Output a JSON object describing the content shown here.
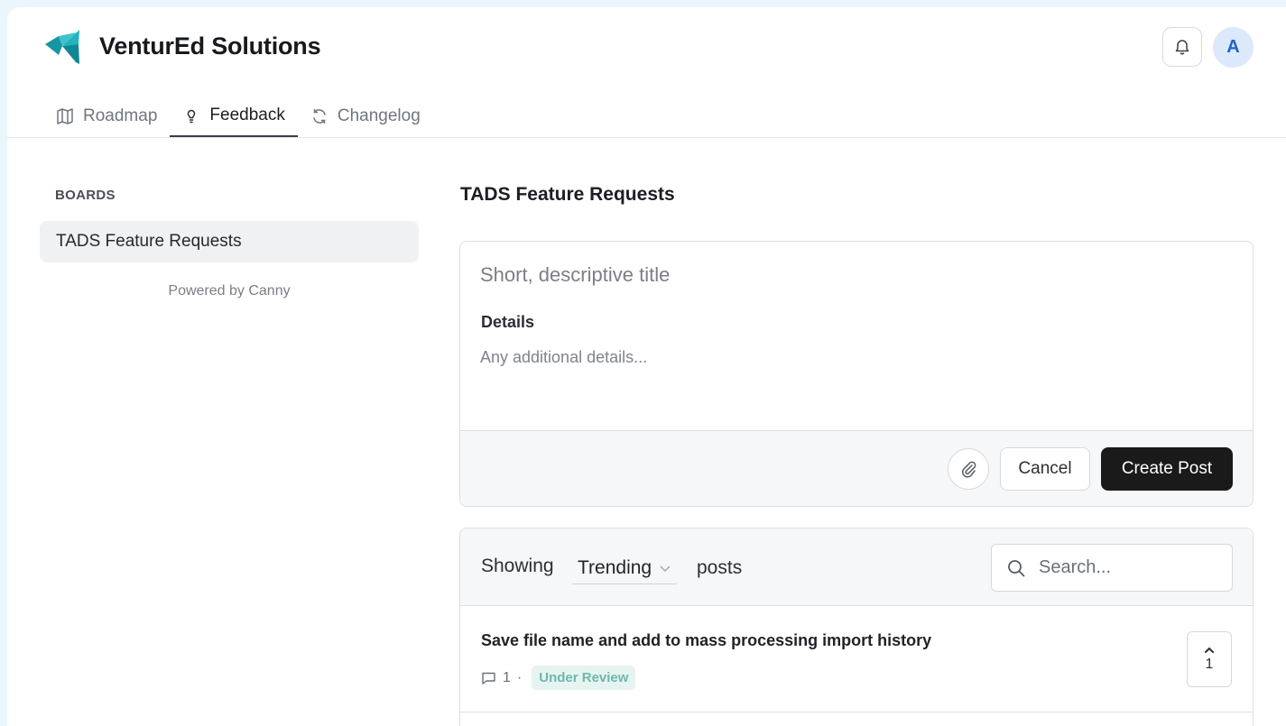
{
  "brand": {
    "name": "VenturEd Solutions"
  },
  "header": {
    "avatar_initial": "A"
  },
  "tabs": [
    {
      "label": "Roadmap",
      "icon": "map-icon",
      "active": false
    },
    {
      "label": "Feedback",
      "icon": "lightbulb-icon",
      "active": true
    },
    {
      "label": "Changelog",
      "icon": "refresh-icon",
      "active": false
    }
  ],
  "sidebar": {
    "heading": "BOARDS",
    "boards": [
      {
        "label": "TADS Feature Requests",
        "selected": true
      }
    ],
    "powered_by": "Powered by Canny"
  },
  "main": {
    "board_title": "TADS Feature Requests",
    "new_post": {
      "title_placeholder": "Short, descriptive title",
      "details_label": "Details",
      "details_placeholder": "Any additional details...",
      "cancel_label": "Cancel",
      "create_label": "Create Post"
    },
    "list": {
      "showing_label": "Showing",
      "sort_value": "Trending",
      "posts_label": "posts",
      "search_placeholder": "Search...",
      "posts": [
        {
          "title": "Save file name and add to mass processing import history",
          "comment_count": "1",
          "separator": "·",
          "status": "Under Review",
          "votes": "1"
        }
      ]
    }
  },
  "colors": {
    "brand_teal": "#1aa3b0",
    "primary_button": "#1a1a1a",
    "avatar_bg": "#dbe9fb",
    "avatar_text": "#1d63c9",
    "status_bg": "#e6f4f1",
    "status_text": "#6fb7a9"
  }
}
